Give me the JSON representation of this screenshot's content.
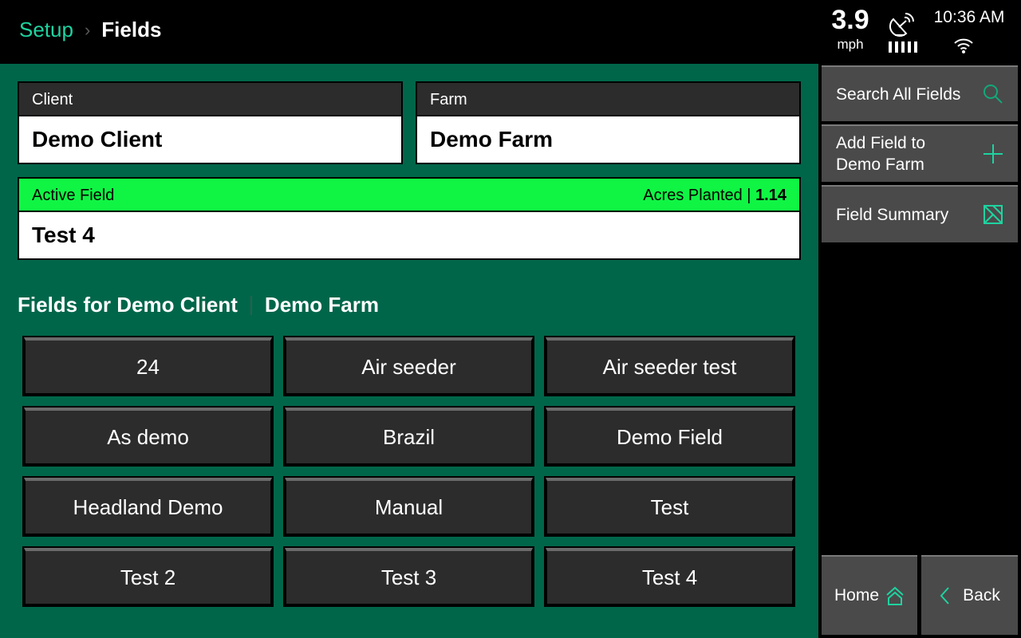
{
  "header": {
    "breadcrumb": {
      "parent": "Setup",
      "separator": "›",
      "current": "Fields"
    },
    "speed": {
      "value": "3.9",
      "unit": "mph"
    },
    "gps_icon": "satellite-dish-icon",
    "signal_bars": 5,
    "clock": "10:36 AM",
    "wifi_icon": "wifi-icon"
  },
  "client": {
    "label": "Client",
    "value": "Demo Client"
  },
  "farm": {
    "label": "Farm",
    "value": "Demo Farm"
  },
  "active_field": {
    "label": "Active Field",
    "acres_label": "Acres Planted |",
    "acres_value": "1.14",
    "value": "Test 4",
    "accent_color": "#10f544"
  },
  "fields_section": {
    "title_left": "Fields for Demo Client",
    "title_right": "Demo Farm",
    "fields": [
      "24",
      "Air seeder",
      "Air seeder test",
      "As demo",
      "Brazil",
      "Demo Field",
      "Headland Demo",
      "Manual",
      "Test",
      "Test 2",
      "Test 3",
      "Test 4"
    ]
  },
  "sidebar": {
    "search": {
      "label": "Search All Fields",
      "icon": "search-icon"
    },
    "add": {
      "label_line1": "Add Field to",
      "label_line2": "Demo Farm",
      "icon": "plus-icon"
    },
    "summary": {
      "label": "Field Summary",
      "icon": "field-summary-icon"
    },
    "home": {
      "label": "Home",
      "icon": "home-icon"
    },
    "back": {
      "label": "Back",
      "icon": "chevron-left-icon"
    }
  },
  "colors": {
    "accent": "#1ed3a0",
    "background": "#00664a",
    "active_green": "#10f544"
  }
}
